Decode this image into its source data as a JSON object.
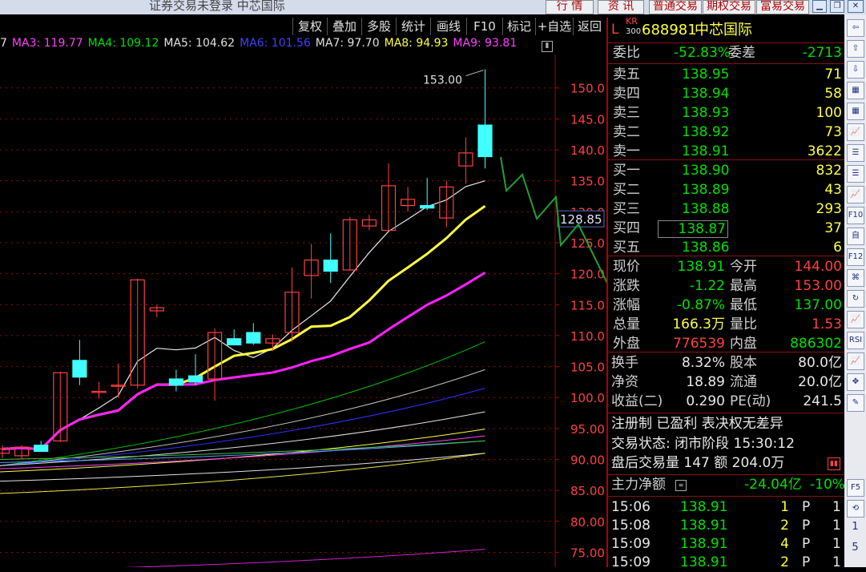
{
  "window": {
    "title": "证券交易未登录  中芯国际",
    "top_buttons": [
      "行 情",
      "资 讯",
      "普通交易",
      "期权交易",
      "富易交易"
    ]
  },
  "toolbar": {
    "items": [
      "复权",
      "叠加",
      "多股",
      "统计",
      "画线",
      "F10",
      "标记",
      "+自选",
      "返回"
    ]
  },
  "ma_legend": [
    {
      "text": "7",
      "color": "#e0e0e0"
    },
    {
      "text": "MA3: 119.77",
      "color": "#ff40ff"
    },
    {
      "text": "MA4: 109.12",
      "color": "#00e000"
    },
    {
      "text": "MA5: 104.62",
      "color": "#e0e0e0"
    },
    {
      "text": "MA6: 101.56",
      "color": "#4040ff"
    },
    {
      "text": "MA7: 97.70",
      "color": "#e0e0e0"
    },
    {
      "text": "MA8: 94.93",
      "color": "#ffff40"
    },
    {
      "text": "MA9: 93.81",
      "color": "#ff40ff"
    }
  ],
  "chart_data": {
    "type": "candlestick",
    "high_label": "153.00",
    "crosshair_label": "128.85",
    "y_ticks": [
      "150.0",
      "145.0",
      "140.0",
      "135.0",
      "130.0",
      "125.0",
      "120.0",
      "115.0",
      "110.0",
      "105.0",
      "100.0",
      "95.00",
      "90.00",
      "85.00",
      "80.00",
      "75.00"
    ],
    "ylim": [
      72.6,
      155.4
    ],
    "candles": [
      {
        "o": 91.0,
        "h": 92.3,
        "l": 90.2,
        "c": 91.7
      },
      {
        "o": 90.6,
        "h": 92.3,
        "l": 90.0,
        "c": 92.0
      },
      {
        "o": 92.3,
        "h": 93.0,
        "l": 91.8,
        "c": 91.3
      },
      {
        "o": 93.0,
        "h": 104.2,
        "l": 92.8,
        "c": 104.0
      },
      {
        "o": 106.0,
        "h": 109.3,
        "l": 102.0,
        "c": 103.3
      },
      {
        "o": 101.0,
        "h": 102.5,
        "l": 99.8,
        "c": 101.0
      },
      {
        "o": 102.0,
        "h": 105.5,
        "l": 100.0,
        "c": 102.0
      },
      {
        "o": 102.0,
        "h": 119.2,
        "l": 101.5,
        "c": 119.0
      },
      {
        "o": 114.0,
        "h": 115.0,
        "l": 113.0,
        "c": 114.5
      },
      {
        "o": 103.0,
        "h": 104.5,
        "l": 101.0,
        "c": 102.0
      },
      {
        "o": 103.5,
        "h": 107.0,
        "l": 102.0,
        "c": 102.5
      },
      {
        "o": 103.0,
        "h": 111.2,
        "l": 99.5,
        "c": 110.5
      },
      {
        "o": 109.5,
        "h": 111.0,
        "l": 108.5,
        "c": 108.5
      },
      {
        "o": 110.5,
        "h": 112.0,
        "l": 108.5,
        "c": 108.8
      },
      {
        "o": 108.8,
        "h": 110.2,
        "l": 107.5,
        "c": 109.5
      },
      {
        "o": 110.5,
        "h": 121.0,
        "l": 109.0,
        "c": 117.0
      },
      {
        "o": 119.7,
        "h": 124.8,
        "l": 116.0,
        "c": 122.2
      },
      {
        "o": 122.2,
        "h": 126.5,
        "l": 118.5,
        "c": 120.4
      },
      {
        "o": 120.6,
        "h": 129.2,
        "l": 120.5,
        "c": 128.7
      },
      {
        "o": 127.7,
        "h": 129.5,
        "l": 127.0,
        "c": 128.7
      },
      {
        "o": 127.0,
        "h": 137.8,
        "l": 127.0,
        "c": 134.2
      },
      {
        "o": 131.0,
        "h": 134.0,
        "l": 130.0,
        "c": 132.0
      },
      {
        "o": 131.0,
        "h": 135.5,
        "l": 130.3,
        "c": 130.6
      },
      {
        "o": 129.0,
        "h": 135.0,
        "l": 127.5,
        "c": 134.0
      },
      {
        "o": 137.4,
        "h": 142.0,
        "l": 134.5,
        "c": 139.5
      },
      {
        "o": 144.0,
        "h": 153.0,
        "l": 137.0,
        "c": 138.9
      }
    ]
  },
  "quote": {
    "code": "688981",
    "name": "中芯国际",
    "badge_top": "KR",
    "badge_bottom": "300",
    "badge_l": "L",
    "wei_bi_label": "委比",
    "wei_bi": "-52.83%",
    "wei_cha_label": "委差",
    "wei_cha": "-2713",
    "asks": [
      {
        "label": "卖五",
        "price": "138.95",
        "vol": "71"
      },
      {
        "label": "卖四",
        "price": "138.94",
        "vol": "58"
      },
      {
        "label": "卖三",
        "price": "138.93",
        "vol": "100"
      },
      {
        "label": "卖二",
        "price": "138.92",
        "vol": "73"
      },
      {
        "label": "卖一",
        "price": "138.91",
        "vol": "3622"
      }
    ],
    "bids": [
      {
        "label": "买一",
        "price": "138.90",
        "vol": "832"
      },
      {
        "label": "买二",
        "price": "138.89",
        "vol": "43"
      },
      {
        "label": "买三",
        "price": "138.88",
        "vol": "293"
      },
      {
        "label": "买四",
        "price": "138.87",
        "vol": "37"
      },
      {
        "label": "买五",
        "price": "138.86",
        "vol": "6"
      }
    ],
    "stats": [
      {
        "l1": "现价",
        "v1": "138.91",
        "c1": "grn",
        "l2": "今开",
        "v2": "144.00",
        "c2": "red"
      },
      {
        "l1": "涨跌",
        "v1": "-1.22",
        "c1": "grn",
        "l2": "最高",
        "v2": "153.00",
        "c2": "red"
      },
      {
        "l1": "涨幅",
        "v1": "-0.87%",
        "c1": "grn",
        "l2": "最低",
        "v2": "137.00",
        "c2": "grn"
      },
      {
        "l1": "总量",
        "v1": "166.3万",
        "c1": "yel",
        "l2": "量比",
        "v2": "1.53",
        "c2": "red"
      },
      {
        "l1": "外盘",
        "v1": "776539",
        "c1": "red",
        "l2": "内盘",
        "v2": "886302",
        "c2": "grn"
      }
    ],
    "fundamentals": [
      {
        "l1": "换手",
        "v1": "8.32%",
        "l2": "股本",
        "v2": "80.0亿"
      },
      {
        "l1": "净资",
        "v1": "18.89",
        "l2": "流通",
        "v2": "20.0亿"
      },
      {
        "l1": "收益(二)",
        "v1": "0.290",
        "l2": "PE(动)",
        "v2": "241.5"
      }
    ],
    "reg_line": "注册制 已盈利 表决权无差异",
    "trade_status": "交易状态: 闭市阶段 15:30:12",
    "after_hours": "盘后交易量 147 额 204.0万",
    "main_flow_label": "主力净额",
    "main_flow_value": "-24.04亿",
    "main_flow_pct": "-10%",
    "ticks": [
      {
        "time": "15:06",
        "price": "138.91",
        "vol": "1",
        "dir": "P",
        "n": "1"
      },
      {
        "time": "15:08",
        "price": "138.91",
        "vol": "2",
        "dir": "P",
        "n": "1"
      },
      {
        "time": "15:09",
        "price": "138.91",
        "vol": "4",
        "dir": "P",
        "n": "1"
      },
      {
        "time": "15:09",
        "price": "138.91",
        "vol": "2",
        "dir": "P",
        "n": "1"
      }
    ]
  },
  "icon_bar": {
    "items": [
      "arrow-left-icon",
      "arrow-up-icon",
      "arrow-down-icon",
      "grid-icon",
      "grid-icon",
      "chart-icon",
      "list-icon",
      "list-icon",
      "chart-icon",
      "F10-icon",
      "self-icon",
      "F12-icon",
      "ext-icon",
      "refresh-icon",
      "chart-icon",
      "RSI-icon",
      "chart-icon",
      "move-icon",
      "pen-icon"
    ],
    "labels": [
      "F10",
      "自",
      "F12",
      "RSI",
      "F5",
      "1",
      "5"
    ]
  },
  "colors": {
    "up": "#ff4040",
    "down": "#40ffff",
    "grid": "#8a1010",
    "drawn_line": "#20a030"
  }
}
